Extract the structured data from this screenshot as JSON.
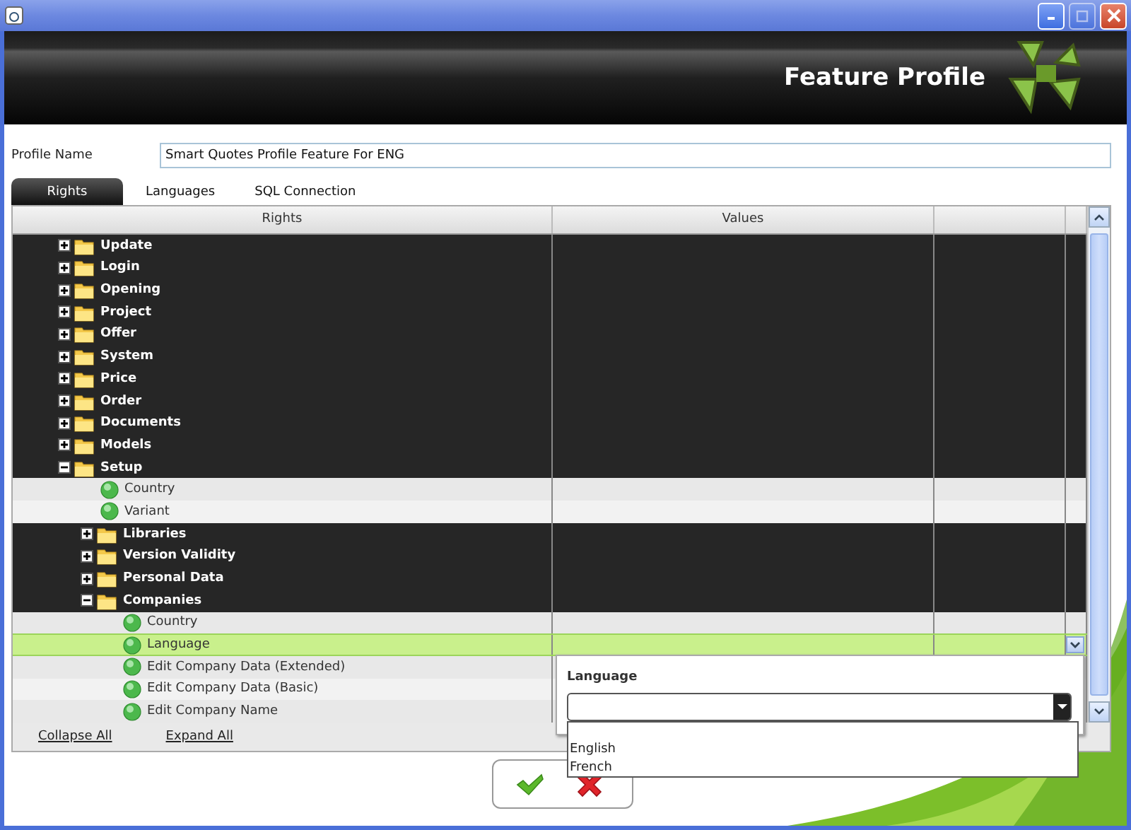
{
  "header": {
    "title": "Feature Profile"
  },
  "profile_name": {
    "label": "Profile Name",
    "value": "Smart Quotes Profile Feature For ENG"
  },
  "tabs": [
    {
      "label": "Rights",
      "selected": true
    },
    {
      "label": "Languages",
      "selected": false
    },
    {
      "label": "SQL Connection",
      "selected": false
    }
  ],
  "grid": {
    "columns": [
      "Rights",
      "Values"
    ],
    "tree": [
      {
        "kind": "folder",
        "label": "Update",
        "expanded": false,
        "selected": false
      },
      {
        "kind": "folder",
        "label": "Login",
        "expanded": false,
        "selected": false
      },
      {
        "kind": "folder",
        "label": "Opening",
        "expanded": false,
        "selected": false
      },
      {
        "kind": "folder",
        "label": "Project",
        "expanded": false,
        "selected": false
      },
      {
        "kind": "folder",
        "label": "Offer",
        "expanded": false,
        "selected": false
      },
      {
        "kind": "folder",
        "label": "System",
        "expanded": false,
        "selected": false
      },
      {
        "kind": "folder",
        "label": "Price",
        "expanded": false,
        "selected": false
      },
      {
        "kind": "folder",
        "label": "Order",
        "expanded": false,
        "selected": false
      },
      {
        "kind": "folder",
        "label": "Documents",
        "expanded": false,
        "selected": false
      },
      {
        "kind": "folder",
        "label": "Models",
        "expanded": false,
        "selected": false
      },
      {
        "kind": "folder",
        "label": "Setup",
        "expanded": true,
        "selected": false,
        "children": [
          {
            "kind": "leaf",
            "label": "Country",
            "selected": false
          },
          {
            "kind": "leaf",
            "label": "Variant",
            "selected": false
          },
          {
            "kind": "folder",
            "label": "Libraries",
            "expanded": false,
            "selected": false
          },
          {
            "kind": "folder",
            "label": "Version Validity",
            "expanded": false,
            "selected": false
          },
          {
            "kind": "folder",
            "label": "Personal Data",
            "expanded": false,
            "selected": false
          },
          {
            "kind": "folder",
            "label": "Companies",
            "expanded": true,
            "selected": false,
            "children": [
              {
                "kind": "leaf",
                "label": "Country",
                "selected": false
              },
              {
                "kind": "leaf",
                "label": "Language",
                "selected": true
              },
              {
                "kind": "leaf",
                "label": "Edit Company Data (Extended)",
                "selected": false
              },
              {
                "kind": "leaf",
                "label": "Edit Company Data (Basic)",
                "selected": false
              },
              {
                "kind": "leaf",
                "label": "Edit Company Name",
                "selected": false
              }
            ]
          }
        ]
      }
    ]
  },
  "popup": {
    "title": "Language",
    "options": [
      "English",
      "French"
    ]
  },
  "footer_links": [
    "Collapse All",
    "Expand All"
  ]
}
